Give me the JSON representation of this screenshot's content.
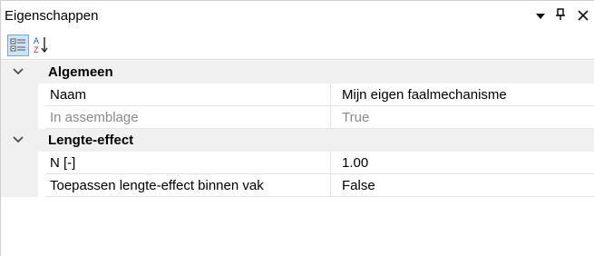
{
  "panel": {
    "title": "Eigenschappen",
    "buttons": {
      "dropdown_icon": "triangle-down-icon",
      "pin_icon": "pin-icon",
      "close_icon": "close-icon"
    }
  },
  "toolbar": {
    "categorized_icon": "categorized-view-icon",
    "alphabetical_icon": "alphabetical-sort-icon"
  },
  "grid": {
    "categories": [
      {
        "label": "Algemeen",
        "properties": [
          {
            "name": "Naam",
            "value": "Mijn eigen faalmechanisme",
            "disabled": false
          },
          {
            "name": "In assemblage",
            "value": "True",
            "disabled": true
          }
        ]
      },
      {
        "label": "Lengte-effect",
        "properties": [
          {
            "name": "N [-]",
            "value": "1.00",
            "disabled": false
          },
          {
            "name": "Toepassen lengte-effect binnen vak",
            "value": "False",
            "disabled": false
          }
        ]
      }
    ]
  }
}
